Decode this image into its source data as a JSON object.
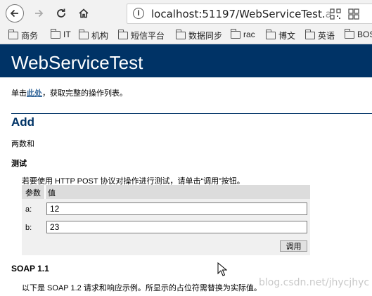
{
  "browser": {
    "url_main": "localhost:51197/WebServiceTest.",
    "url_faded": "a"
  },
  "bookmarks": [
    {
      "label": "商务"
    },
    {
      "label": "IT"
    },
    {
      "label": "机构"
    },
    {
      "label": "短信平台"
    },
    {
      "label": "数据同步"
    },
    {
      "label": "rac"
    },
    {
      "label": "博文"
    },
    {
      "label": "英语"
    },
    {
      "label": "BOS"
    }
  ],
  "page": {
    "title": "WebServiceTest",
    "intro_prefix": "单击",
    "intro_link": "此处",
    "intro_suffix": "，获取完整的操作列表。",
    "operation_title": "Add",
    "operation_desc": "两数和",
    "test_heading": "测试",
    "test_note": "若要使用 HTTP POST 协议对操作进行测试，请单击“调用”按钮。",
    "param_header": "参数",
    "value_header": "值",
    "params": [
      {
        "label": "a:",
        "value": "12"
      },
      {
        "label": "b:",
        "value": "23"
      }
    ],
    "invoke_label": "调用",
    "soap_heading": "SOAP 1.1",
    "soap_note": "以下是 SOAP 1.2 请求和响应示例。所显示的占位符需替换为实际值。"
  },
  "watermark": "blog.csdn.net/jhycjhyc",
  "colors": {
    "header_bg": "#003366",
    "accent": "#003366",
    "link": "#336699"
  }
}
